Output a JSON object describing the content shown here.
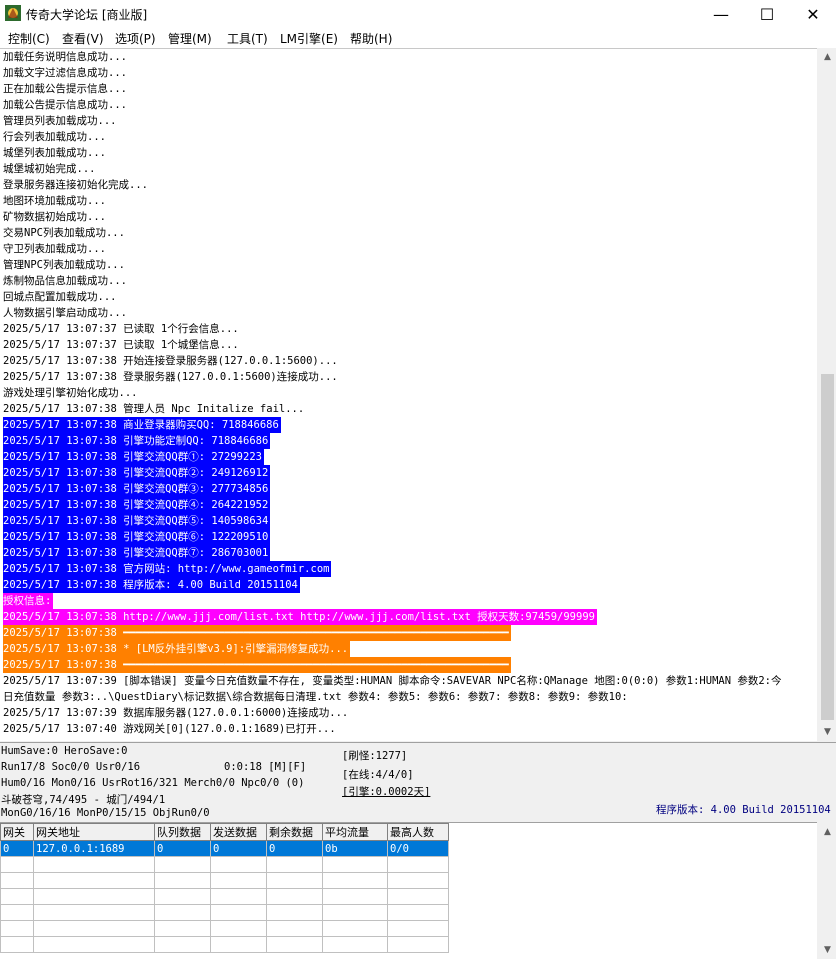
{
  "window": {
    "title": "传奇大学论坛 [商业版]",
    "minimize": "—",
    "maximize": "☐",
    "close": "✕"
  },
  "menu": [
    "控制(C)",
    "查看(V)",
    "选项(P)",
    "管理(M)",
    "工具(T)",
    "LM引擎(E)",
    "帮助(H)"
  ],
  "log": [
    {
      "text": "加载任务说明信息成功...",
      "hl": ""
    },
    {
      "text": "加载文字过滤信息成功...",
      "hl": ""
    },
    {
      "text": "正在加载公告提示信息...",
      "hl": ""
    },
    {
      "text": "加载公告提示信息成功...",
      "hl": ""
    },
    {
      "text": "管理员列表加载成功...",
      "hl": ""
    },
    {
      "text": "行会列表加载成功...",
      "hl": ""
    },
    {
      "text": "城堡列表加载成功...",
      "hl": ""
    },
    {
      "text": "城堡城初始完成...",
      "hl": ""
    },
    {
      "text": "登录服务器连接初始化完成...",
      "hl": ""
    },
    {
      "text": "地图环境加载成功...",
      "hl": ""
    },
    {
      "text": "矿物数据初始成功...",
      "hl": ""
    },
    {
      "text": "交易NPC列表加载成功...",
      "hl": ""
    },
    {
      "text": "守卫列表加载成功...",
      "hl": ""
    },
    {
      "text": "管理NPC列表加载成功...",
      "hl": ""
    },
    {
      "text": "炼制物品信息加载成功...",
      "hl": ""
    },
    {
      "text": "回城点配置加载成功...",
      "hl": ""
    },
    {
      "text": "人物数据引擎启动成功...",
      "hl": ""
    },
    {
      "text": "2025/5/17 13:07:37 已读取 1个行会信息...",
      "hl": ""
    },
    {
      "text": "2025/5/17 13:07:37 已读取 1个城堡信息...",
      "hl": ""
    },
    {
      "text": "2025/5/17 13:07:38 开始连接登录服务器(127.0.0.1:5600)...",
      "hl": ""
    },
    {
      "text": "2025/5/17 13:07:38 登录服务器(127.0.0.1:5600)连接成功...",
      "hl": ""
    },
    {
      "text": "游戏处理引擎初始化成功...",
      "hl": ""
    },
    {
      "text": "2025/5/17 13:07:38 管理人员 Npc Initalize fail...",
      "hl": ""
    },
    {
      "text": "2025/5/17 13:07:38 商业登录器购买QQ: 718846686",
      "hl": "blue"
    },
    {
      "text": "2025/5/17 13:07:38 引擎功能定制QQ: 718846686",
      "hl": "blue"
    },
    {
      "text": "2025/5/17 13:07:38 引擎交流QQ群①: 27299223",
      "hl": "blue"
    },
    {
      "text": "2025/5/17 13:07:38 引擎交流QQ群②: 249126912",
      "hl": "blue"
    },
    {
      "text": "2025/5/17 13:07:38 引擎交流QQ群③: 277734856",
      "hl": "blue"
    },
    {
      "text": "2025/5/17 13:07:38 引擎交流QQ群④: 264221952",
      "hl": "blue"
    },
    {
      "text": "2025/5/17 13:07:38 引擎交流QQ群⑤: 140598634",
      "hl": "blue"
    },
    {
      "text": "2025/5/17 13:07:38 引擎交流QQ群⑥: 122209510",
      "hl": "blue"
    },
    {
      "text": "2025/5/17 13:07:38 引擎交流QQ群⑦: 286703001",
      "hl": "blue"
    },
    {
      "text": "2025/5/17 13:07:38 官方网站: http://www.gameofmir.com",
      "hl": "blue"
    },
    {
      "text": "2025/5/17 13:07:38 程序版本: 4.00 Build 20151104",
      "hl": "blue"
    },
    {
      "text": "授权信息:",
      "hl": "magenta"
    },
    {
      "text": "2025/5/17 13:07:38 http://www.jjj.com/list.txt http://www.jjj.com/list.txt 授权天数:97459/99999",
      "hl": "magenta"
    },
    {
      "text": "2025/5/17 13:07:38 ━━━━━━━━━━━━━━━━━━━━━━━━━━━━━━━━━━━━━━━━━━━━━━━━━━━━━━━━━━━━━",
      "hl": "orange"
    },
    {
      "text": "2025/5/17 13:07:38 * [LM反外挂引擎v3.9]:引擎漏洞修复成功...",
      "hl": "orange"
    },
    {
      "text": "2025/5/17 13:07:38 ━━━━━━━━━━━━━━━━━━━━━━━━━━━━━━━━━━━━━━━━━━━━━━━━━━━━━━━━━━━━━",
      "hl": "orange"
    },
    {
      "text": "2025/5/17 13:07:39 [脚本错误] 变量今日充值数量不存在, 变量类型:HUMAN 脚本命令:SAVEVAR NPC名称:QManage 地图:0(0:0) 参数1:HUMAN 参数2:今",
      "hl": ""
    },
    {
      "text": "日充值数量 参数3:..\\QuestDiary\\标记数据\\综合数据每日清理.txt 参数4: 参数5: 参数6: 参数7: 参数8: 参数9: 参数10:",
      "hl": ""
    },
    {
      "text": "2025/5/17 13:07:39 数据库服务器(127.0.0.1:6000)连接成功...",
      "hl": ""
    },
    {
      "text": "2025/5/17 13:07:40 游戏网关[0](127.0.0.1:1689)已打开...",
      "hl": ""
    }
  ],
  "status": {
    "line1": "HumSave:0 HeroSave:0",
    "line2": "Run17/8 Soc0/0 Usr0/16",
    "time": "0:0:18 [M][F]",
    "line3": "Hum0/16 Mon0/16 UsrRot16/321 Merch0/0 Npc0/0 (0)",
    "line4": "斗破苍穹,74/495 - 城门/494/1",
    "line5": "MonG0/16/16 MonP0/15/15 ObjRun0/0",
    "refresh": "[刷怪:1277]",
    "online": "[在线:4/4/0]",
    "engine": "[引擎:0.0002天]",
    "version": "程序版本: 4.00 Build 20151104"
  },
  "grid": {
    "headers": [
      "网关",
      "网关地址",
      "队列数据",
      "发送数据",
      "剩余数据",
      "平均流量",
      "最高人数"
    ],
    "rows": [
      [
        "0",
        "127.0.0.1:1689",
        "0",
        "0",
        "0",
        "0b",
        "0/0"
      ]
    ]
  },
  "colors": {
    "highlight_blue": "#0000ff",
    "highlight_magenta": "#ff00ff",
    "highlight_orange": "#ff8000",
    "selection": "#0078d7",
    "version_text": "#000080"
  }
}
